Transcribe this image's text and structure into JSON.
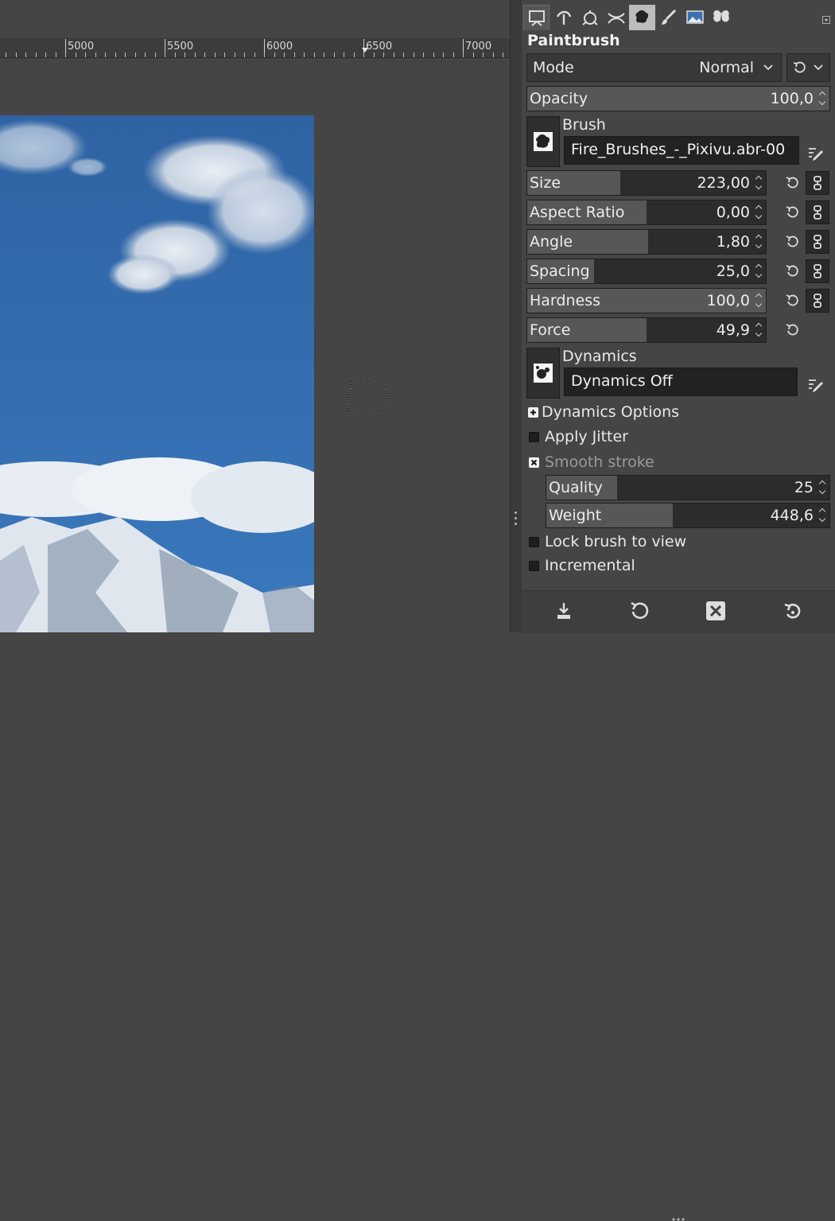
{
  "ruler": {
    "labels": [
      "5000",
      "5500",
      "6000",
      "6500",
      "7000"
    ]
  },
  "dock_tabs": [
    {
      "icon": "tool-options-icon",
      "active": true
    },
    {
      "icon": "paths-tool-icon",
      "active": false
    },
    {
      "icon": "transform-tool-icon",
      "active": false
    },
    {
      "icon": "handle-transform-icon",
      "active": false
    },
    {
      "icon": "brush-preset-icon",
      "active": false
    },
    {
      "icon": "paintbrush-tool-icon",
      "active": false
    },
    {
      "icon": "image-icon",
      "active": false
    },
    {
      "icon": "butterfly-icon",
      "active": false
    }
  ],
  "tool": {
    "title": "Paintbrush",
    "mode_label": "Mode",
    "mode_value": "Normal",
    "opacity_label": "Opacity",
    "opacity_value": "100,0",
    "opacity_fraction": 1.0,
    "brush_label": "Brush",
    "brush_value": "Fire_Brushes_-_Pixivu.abr-00",
    "sliders": [
      {
        "label": "Size",
        "value": "223,00",
        "fill": 0.39,
        "chain": true
      },
      {
        "label": "Aspect Ratio",
        "value": "0,00",
        "fill": 0.5,
        "chain": true
      },
      {
        "label": "Angle",
        "value": "1,80",
        "fill": 0.505,
        "chain": true
      },
      {
        "label": "Spacing",
        "value": "25,0",
        "fill": 0.28,
        "chain": true
      },
      {
        "label": "Hardness",
        "value": "100,0",
        "fill": 1.0,
        "chain": true
      },
      {
        "label": "Force",
        "value": "49,9",
        "fill": 0.499,
        "chain": false
      }
    ],
    "dynamics_label": "Dynamics",
    "dynamics_value": "Dynamics Off",
    "dynamics_options_label": "Dynamics Options",
    "apply_jitter_label": "Apply Jitter",
    "smooth_stroke_label": "Smooth stroke",
    "quality_label": "Quality",
    "quality_value": "25",
    "quality_fraction": 0.25,
    "weight_label": "Weight",
    "weight_value": "448,6",
    "weight_fraction": 0.448,
    "lock_brush_label": "Lock brush to view",
    "incremental_label": "Incremental"
  },
  "colors": {
    "panel_bg": "#454545",
    "field_bg": "#2c2c2c",
    "slider_fill": "#575757",
    "sky": "#2f68a8"
  }
}
